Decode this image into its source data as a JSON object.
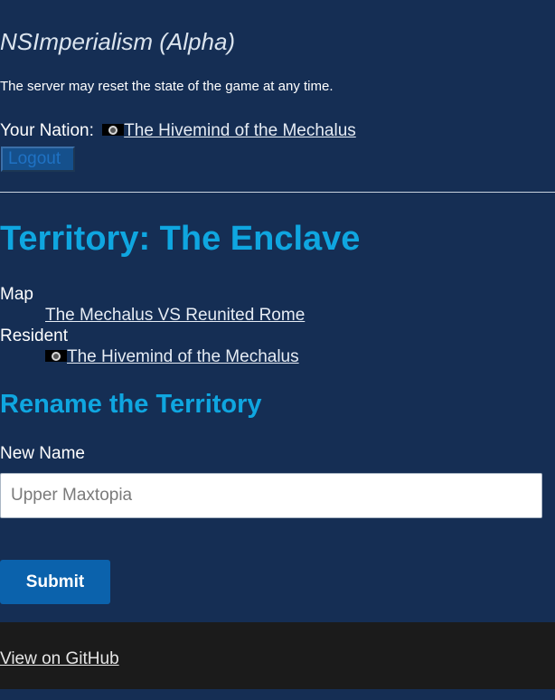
{
  "site": {
    "title": "NSImperialism (Alpha)",
    "notice": "The server may reset the state of the game at any time."
  },
  "account": {
    "nation_label": "Your Nation:",
    "nation_flag_icon": "nation-flag-icon",
    "nation_name": "The Hivemind of the Mechalus",
    "logout_label": "Logout"
  },
  "territory": {
    "heading": "Territory: The Enclave",
    "map_label": "Map",
    "map_name": "The Mechalus VS Reunited Rome",
    "resident_label": "Resident",
    "resident_flag_icon": "nation-flag-icon",
    "resident_name": "The Hivemind of the Mechalus"
  },
  "rename_form": {
    "heading": "Rename the Territory",
    "field_label": "New Name",
    "field_value": "",
    "field_placeholder": "Upper Maxtopia",
    "submit_label": "Submit"
  },
  "footer": {
    "github_link": "View on GitHub"
  },
  "colors": {
    "background": "#152e54",
    "heading_accent": "#0fa6e0",
    "button_primary": "#0b62ac",
    "footer_background": "#1b1b1b"
  }
}
